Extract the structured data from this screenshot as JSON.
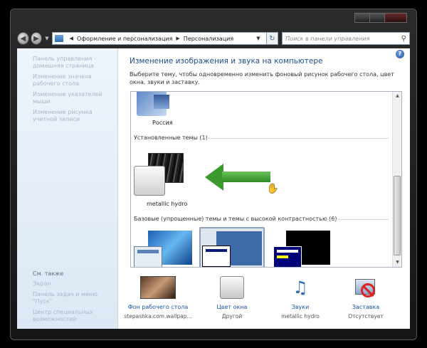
{
  "address_bar": {
    "crumbs": [
      "Оформление и персонализация",
      "Персонализация"
    ],
    "search_placeholder": "Поиск в панели управления"
  },
  "sidebar": {
    "items": [
      "Панель управления - домашняя страница",
      "Изменение значков рабочего стола",
      "Изменение указателей мыши",
      "Изменение рисунка учетной записи"
    ],
    "see_also_title": "См. также",
    "see_also": [
      "Экран",
      "Панель задач и меню \"Пуск\"",
      "Центр специальных возможностей"
    ]
  },
  "main": {
    "title": "Изменение изображения и звука на компьютере",
    "description": "Выберите тему, чтобы одновременно изменить фоновый рисунок рабочего стола, цвет окна, звуки и заставку.",
    "theme_russia": "Россия",
    "installed_group": "Установленные темы (1)",
    "theme_hydro": "metallic hydro",
    "basic_group": "Базовые (упрощенные) темы и темы с высокой контрастностью (6)"
  },
  "bottom": {
    "wallpaper": {
      "label": "Фон рабочего стола",
      "value": "stepashka.com.wallpap..."
    },
    "color": {
      "label": "Цвет окна",
      "value": "Другой"
    },
    "sounds": {
      "label": "Звуки",
      "value": "metallic hydro"
    },
    "screensaver": {
      "label": "Заставка",
      "value": "Отсутствует"
    }
  },
  "colors": {
    "accent_link": "#1a55a8",
    "title_blue": "#1e4d8c",
    "arrow_green": "#3a9a2e"
  },
  "icons": [
    "back-arrow-icon",
    "forward-arrow-icon",
    "control-panel-icon",
    "refresh-icon",
    "search-icon",
    "help-icon",
    "arrow-pointer-icon",
    "hand-cursor-icon"
  ]
}
